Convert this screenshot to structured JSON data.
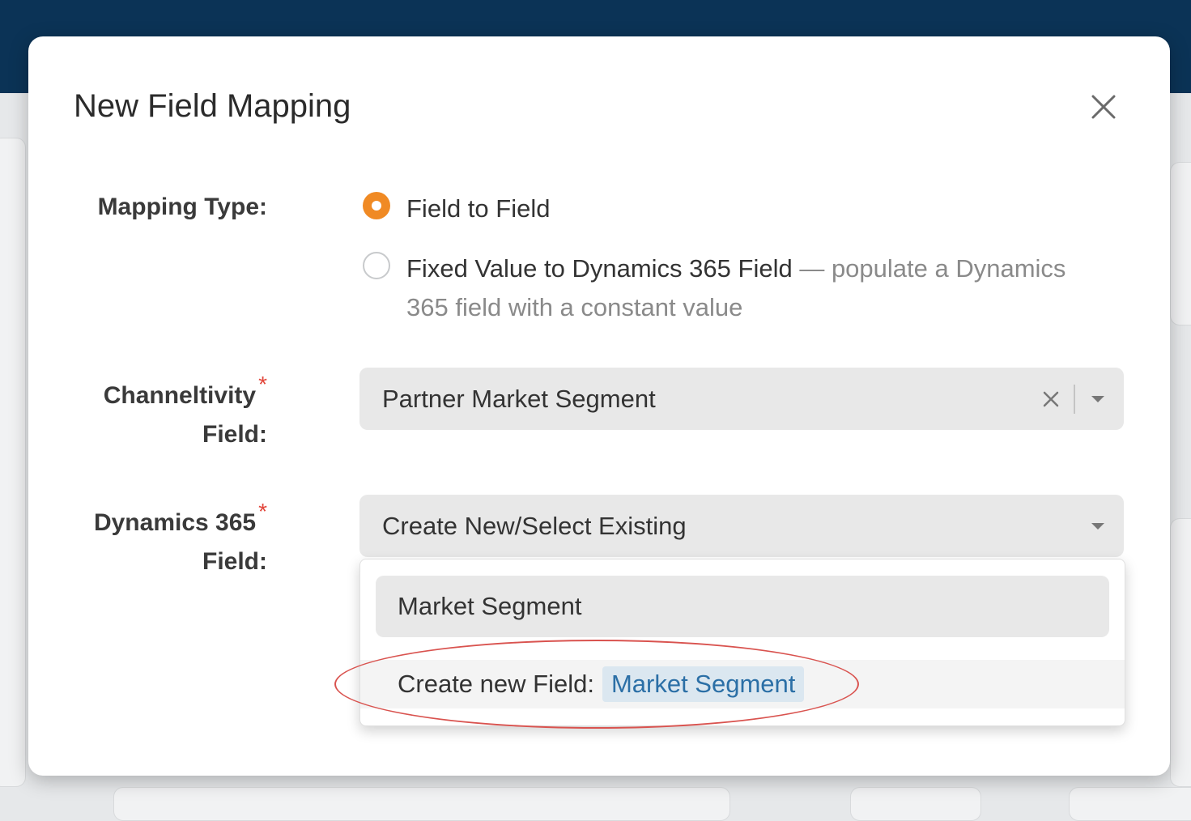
{
  "modal": {
    "title": "New Field Mapping"
  },
  "mapping_type": {
    "label": "Mapping Type:",
    "options": [
      {
        "label": "Field to Field",
        "selected": true
      },
      {
        "label": "Fixed Value to Dynamics 365 Field",
        "description": "— populate a Dynamics 365 field with a constant value",
        "selected": false
      }
    ]
  },
  "channeltivity_field": {
    "label_line1": "Channeltivity",
    "label_line2": "Field:",
    "required_mark": "*",
    "value": "Partner Market Segment"
  },
  "dynamics_field": {
    "label_line1": "Dynamics 365",
    "label_line2": "Field:",
    "required_mark": "*",
    "placeholder": "Create New/Select Existing",
    "dropdown": {
      "search_value": "Market Segment",
      "create_option_prefix": "Create new Field:",
      "create_option_value": "Market Segment"
    }
  },
  "colors": {
    "accent": "#f08a24",
    "topbar": "#0b3356",
    "required": "#e2463b",
    "highlight": "#d9534f",
    "chip_bg": "#dbe7f0",
    "chip_text": "#2b6fa6"
  },
  "icons": {
    "close": "close-icon",
    "clear": "clear-x-icon",
    "caret": "chevron-down-icon"
  }
}
